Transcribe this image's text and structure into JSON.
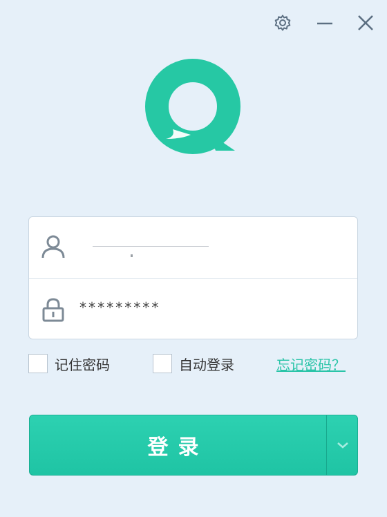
{
  "window": {
    "settings_icon": "gear-icon",
    "minimize_icon": "minimize-icon",
    "close_icon": "close-icon"
  },
  "logo": {
    "icon": "chat-bubble-logo",
    "color": "#26c8a4"
  },
  "account": {
    "user_icon": "user-icon",
    "username_value": "",
    "lock_icon": "lock-icon",
    "password_value": "*********"
  },
  "options": {
    "remember_label": "记住密码",
    "auto_login_label": "自动登录",
    "forgot_label": "忘记密码？"
  },
  "login": {
    "button_label": "登录",
    "dropdown_icon": "chevron-down-icon",
    "accent_color": "#22c9a8"
  }
}
